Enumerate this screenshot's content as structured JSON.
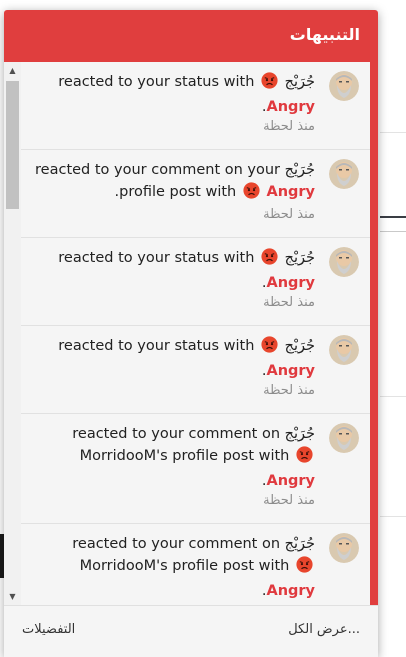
{
  "header": {
    "title": "التنبيهات"
  },
  "notifications": [
    {
      "user": "جُرَيْج",
      "text": "reacted to your status with",
      "reaction": "Angry",
      "end": ".",
      "time": "منذ لحظة"
    },
    {
      "user": "جُرَيْج",
      "text": "reacted to your comment on your profile post with",
      "reaction": "Angry",
      "end": ".",
      "time": "منذ لحظة"
    },
    {
      "user": "جُرَيْج",
      "text": "reacted to your status with",
      "reaction": "Angry",
      "end": ".",
      "time": "منذ لحظة"
    },
    {
      "user": "جُرَيْج",
      "text": "reacted to your status with",
      "reaction": "Angry",
      "end": ".",
      "time": "منذ لحظة"
    },
    {
      "user": "جُرَيْج",
      "text": "reacted to your comment on MorridooM's profile post with",
      "reaction": "Angry",
      "end": ".",
      "time": "منذ لحظة"
    },
    {
      "user": "جُرَيْج",
      "text": "reacted to your comment on MorridooM's profile post with",
      "reaction": "Angry",
      "end": ".",
      "time": ""
    }
  ],
  "icons": {
    "avatar": "old-man-avatar-icon",
    "emoji": "angry-face-icon",
    "scroll_up": "arrow-up-icon",
    "scroll_down": "arrow-down-icon"
  },
  "colors": {
    "accent": "#e03e3e",
    "reaction": "#e0393e",
    "item_bg": "#f5f5f5"
  },
  "footer": {
    "view_all": "عرض الكل...",
    "preferences": "التفضيلات"
  }
}
